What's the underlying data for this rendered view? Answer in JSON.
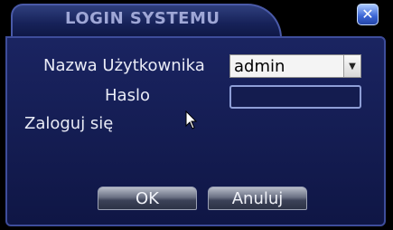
{
  "dialog": {
    "title": "LOGIN SYSTEMU",
    "close_icon": "close-icon"
  },
  "form": {
    "username_label": "Nazwa Użytkownika",
    "username_value": "admin",
    "password_label": "Haslo",
    "password_value": "",
    "login_status": "Zaloguj się"
  },
  "buttons": {
    "ok_label": "OK",
    "cancel_label": "Anuluj"
  },
  "colors": {
    "panel": "#1a2461",
    "border": "#3e4d9b",
    "accent_close": "#3a64d4"
  }
}
